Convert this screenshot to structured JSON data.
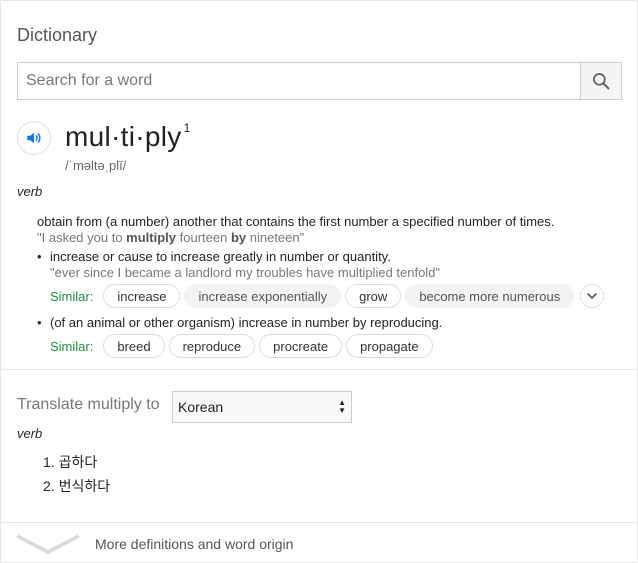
{
  "header": {
    "title": "Dictionary"
  },
  "search": {
    "placeholder": "Search for a word",
    "icon": "search-icon"
  },
  "entry": {
    "word": "mul·ti·ply",
    "superscript": "1",
    "phonetic": "/ˈməltəˌplī/",
    "part_of_speech": "verb",
    "definition": "obtain from (a number) another that contains the first number a specified number of times.",
    "example_parts": [
      "\"I asked you to ",
      "multiply",
      " fourteen ",
      "by",
      " nineteen\""
    ],
    "senses": [
      {
        "bullet": "•",
        "definition": "increase or cause to increase greatly in number or quantity.",
        "example": "\"ever since I became a landlord my troubles have multiplied tenfold\"",
        "similar_label": "Similar:",
        "similar": [
          "increase",
          "increase exponentially",
          "grow",
          "become more numerous"
        ]
      },
      {
        "bullet": "•",
        "definition": "(of an animal or other organism) increase in number by reproducing.",
        "similar_label": "Similar:",
        "similar": [
          "breed",
          "reproduce",
          "procreate",
          "propagate"
        ]
      }
    ]
  },
  "translate": {
    "label": "Translate multiply to",
    "language": "Korean",
    "part_of_speech": "verb",
    "items": [
      "1. 곱하다",
      "2. 번식하다"
    ]
  },
  "footer": {
    "more_label": "More definitions and word origin"
  },
  "colors": {
    "similar_label": "#1e8e3e",
    "speaker_icon": "#1a73e8"
  }
}
